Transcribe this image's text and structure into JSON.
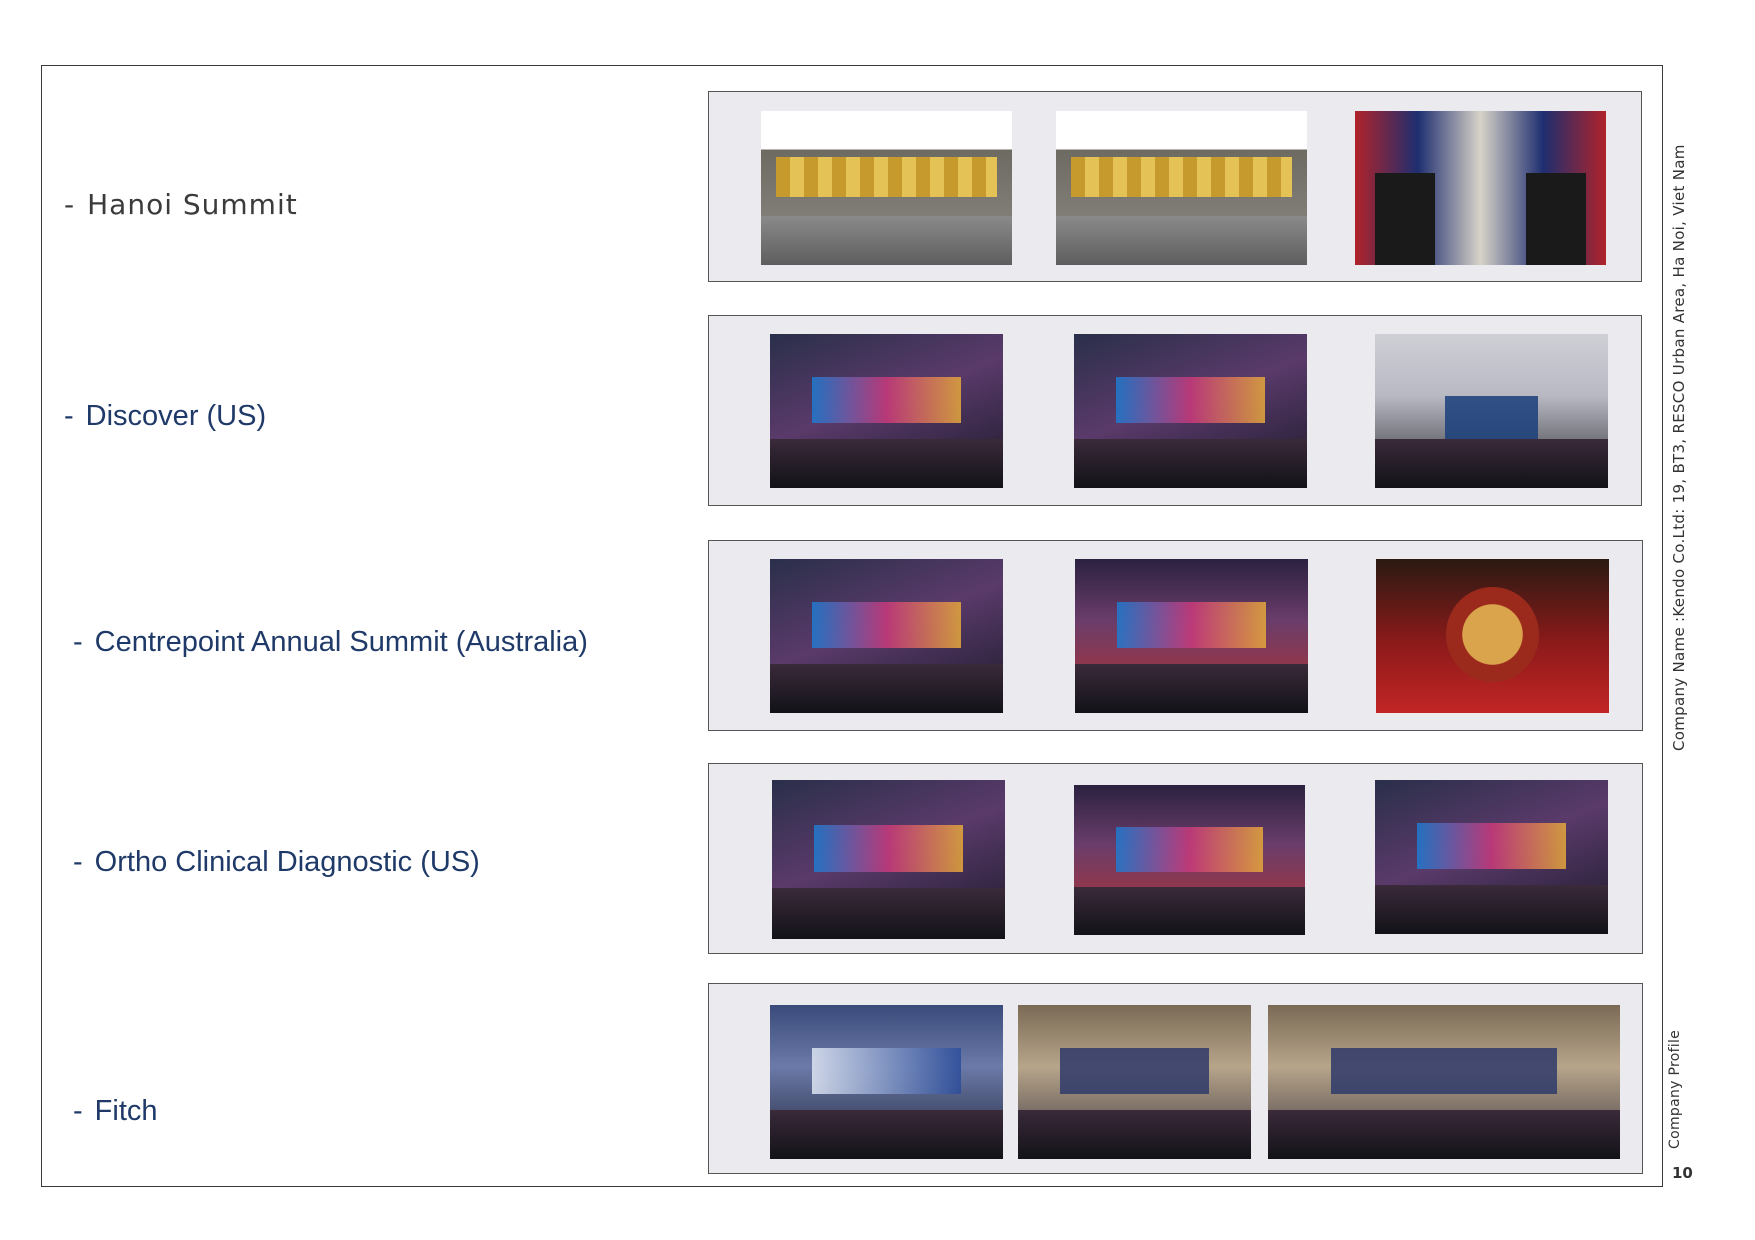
{
  "sections": [
    {
      "label": "Hanoi Summit",
      "photos": [
        "stage-render-1",
        "stage-render-2",
        "summit-meeting"
      ]
    },
    {
      "label": "Discover (US)",
      "photos": [
        "conference-stage",
        "ballroom-presentation",
        "av-control-desk"
      ]
    },
    {
      "label": "Centrepoint Annual Summit (Australia)",
      "photos": [
        "audience-screen",
        "lantern-banquet",
        "red-backdrop"
      ]
    },
    {
      "label": "Ortho Clinical Diagnostic (US)",
      "photos": [
        "stage-speaker",
        "dance-performance",
        "awards-stage"
      ]
    },
    {
      "label": "Fitch",
      "photos": [
        "fitch-conference",
        "fitch-speaker",
        "fitch-ballroom"
      ]
    }
  ],
  "sidebar": {
    "company": "Company Name   :Kendo Co.Ltd:  19, BT3, RESCO Urban Area, Ha Noi, Viet Nam",
    "profile": "Company Profile",
    "page_number": "10"
  },
  "dash": "-"
}
